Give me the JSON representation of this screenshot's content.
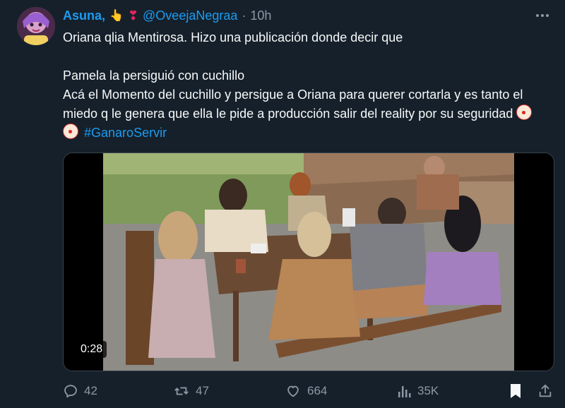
{
  "tweet": {
    "author_name": "Asuna,",
    "handle": "@OveejaNegraa",
    "separator": "·",
    "time": "10h",
    "icons": [
      "hand-emoji-icon",
      "heart-exclamation-icon",
      "more-icon"
    ],
    "lines": [
      "Oriana qlia Mentirosa. Hizo una publicación donde decir que",
      "Pamela la persiguió con cuchillo",
      "Acá el Momento del cuchillo y persigue a Oriana para querer cortarla y es tanto el miedo q le genera que ella le pide a producción salir del reality por su seguridad"
    ],
    "hashtag": "#GanaroServir"
  },
  "media": {
    "duration": "0:28"
  },
  "actions": {
    "replies": "42",
    "retweets": "47",
    "likes": "664",
    "views": "35K"
  },
  "colors": {
    "background": "#15202b",
    "accent": "#1d9bf0",
    "muted": "#8b98a5"
  }
}
